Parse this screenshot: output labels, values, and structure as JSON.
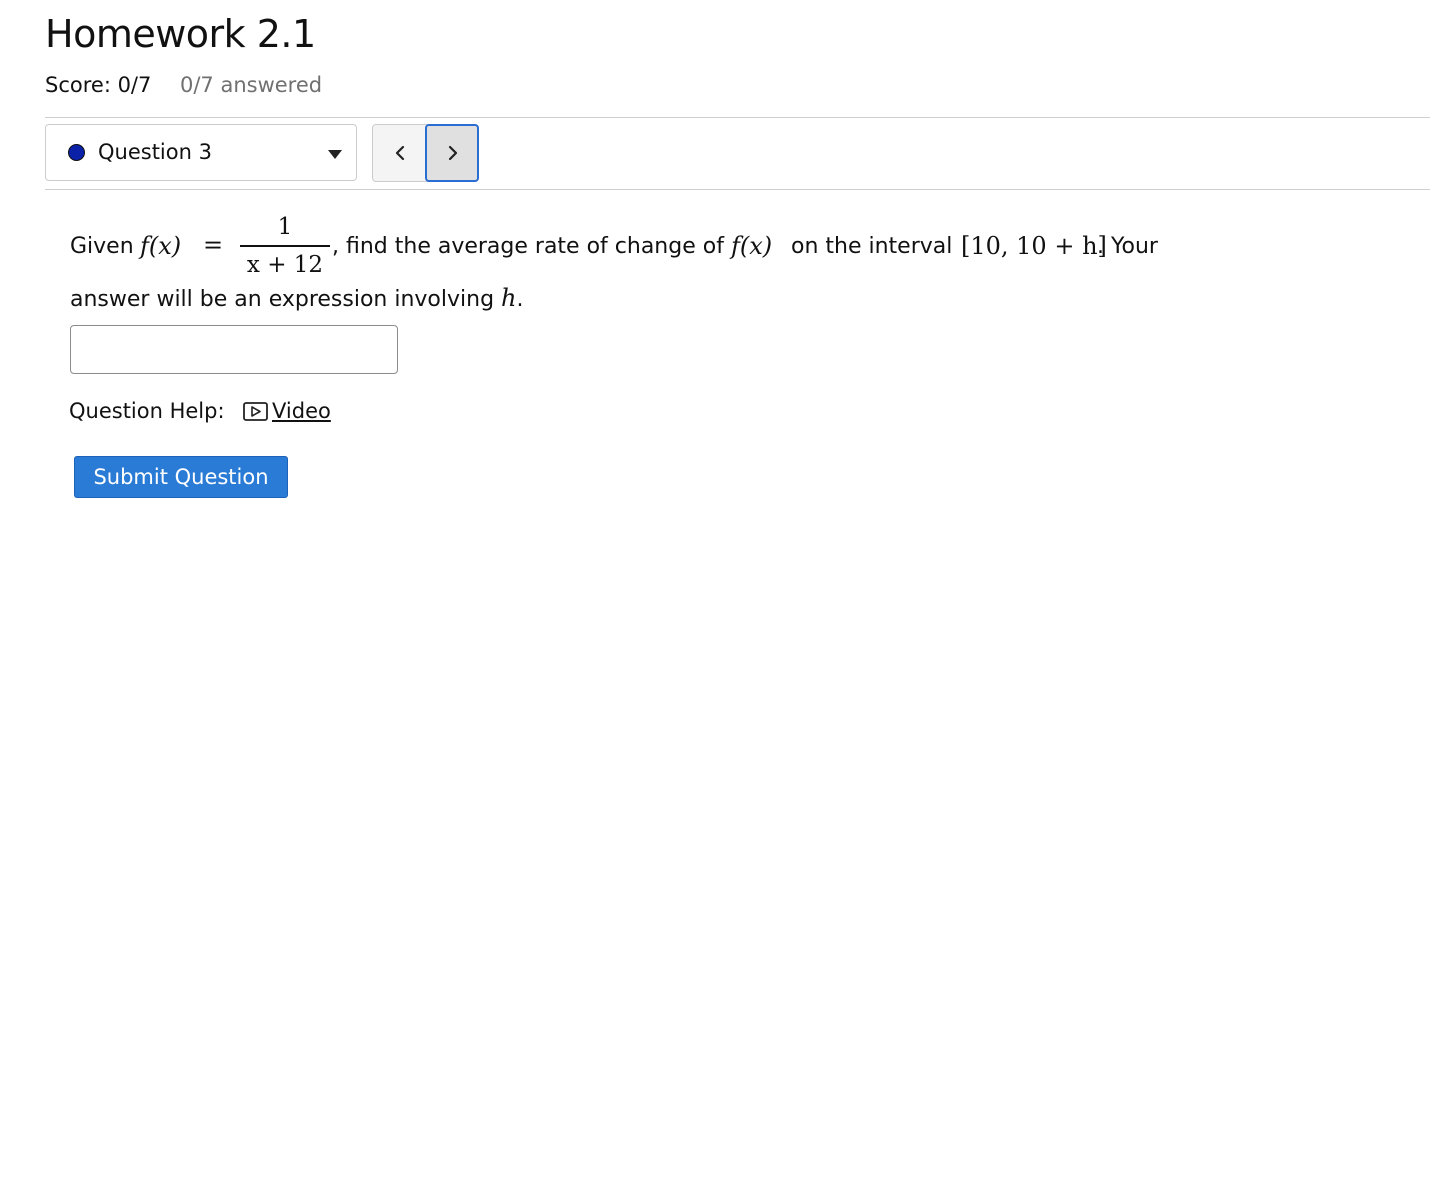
{
  "assignment": {
    "title": "Homework 2.1",
    "score": "Score: 0/7",
    "answered": "0/7 answered"
  },
  "question_nav": {
    "selected": "Question 3",
    "status_color": "#0a21a8",
    "prev_icon": "chevron-left-icon",
    "next_icon": "chevron-right-icon"
  },
  "question": {
    "given": "Given",
    "f_of_x": "f(x)",
    "equals": "=",
    "fraction": {
      "numerator": "1",
      "denominator": "x + 12"
    },
    "text_after_fraction": ", find the average rate of change of",
    "f_of_x_2": "f(x)",
    "text_interval": "on the interval",
    "interval": "[10, 10 + h]",
    "text_end_line1": ". Your",
    "line2_text": "answer will be an expression involving",
    "variable": "h",
    "period": "."
  },
  "answer": {
    "value": "",
    "placeholder": ""
  },
  "help": {
    "label": "Question Help:",
    "video_label": "Video",
    "video_icon": "play-video-icon"
  },
  "submit": {
    "label": "Submit Question",
    "color": "#2a7bd6"
  }
}
